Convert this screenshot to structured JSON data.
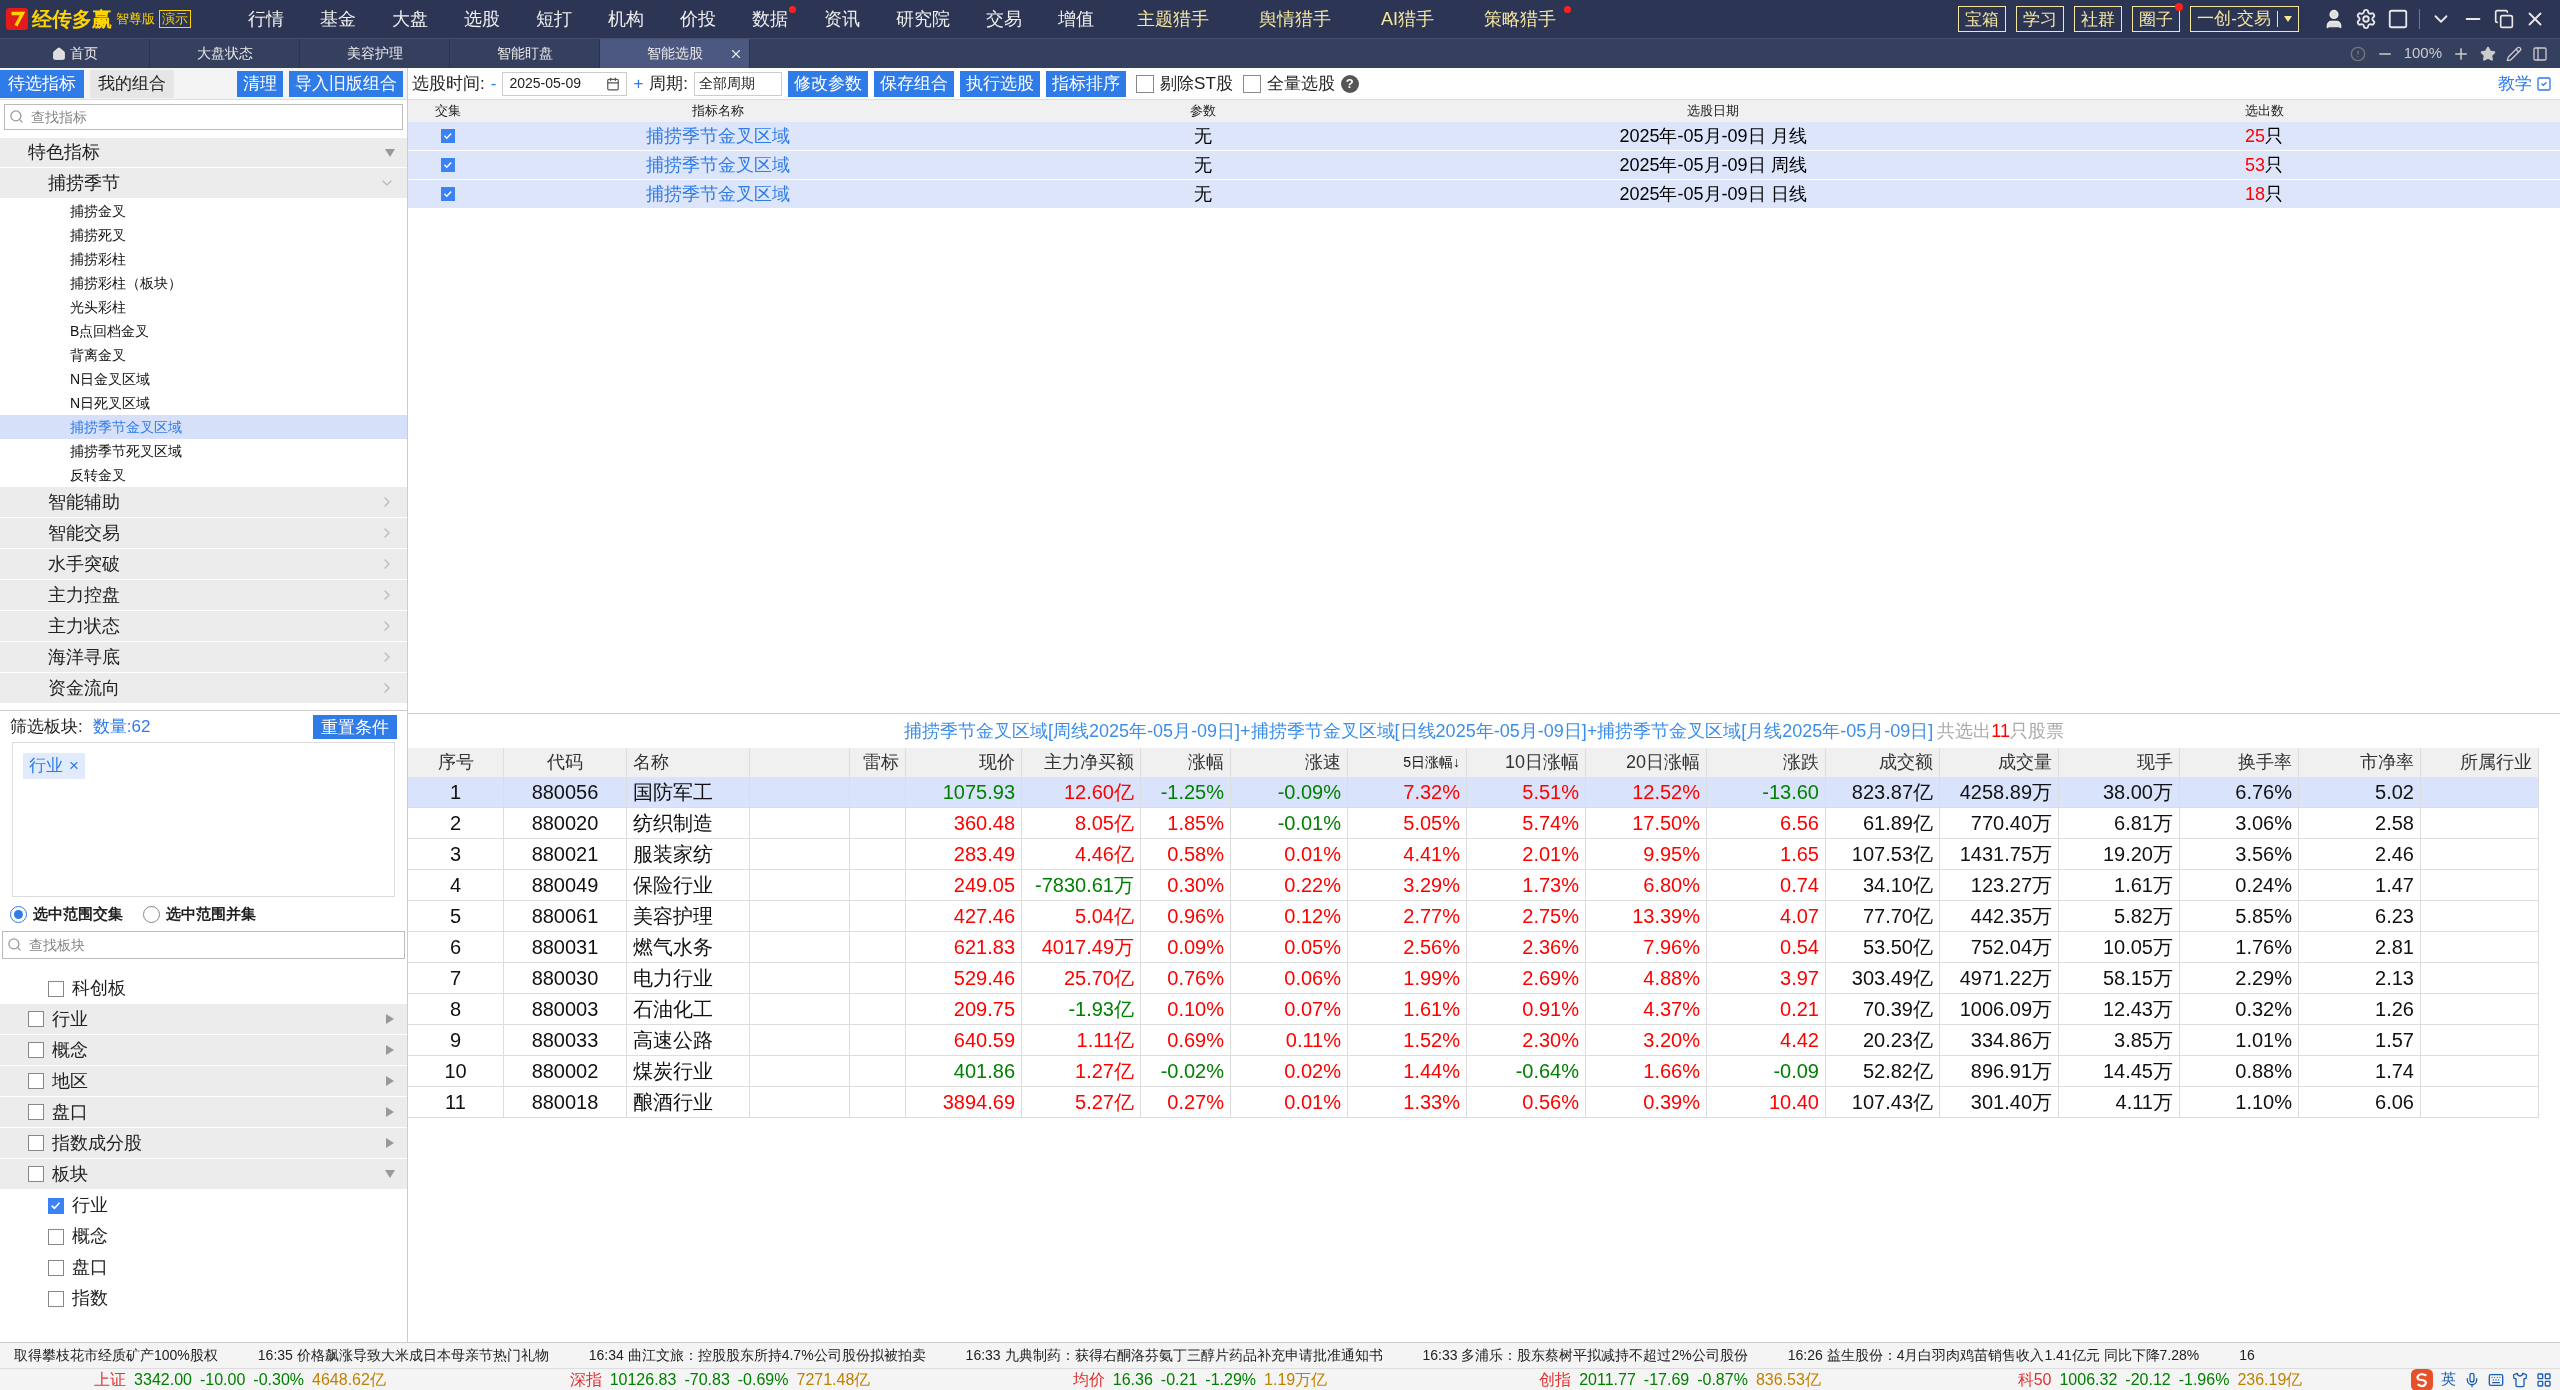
{
  "app": {
    "brand": "经传多赢",
    "edition": "智尊版",
    "mode": "演示"
  },
  "menu": [
    {
      "label": "行情",
      "kind": "plain",
      "dot": false
    },
    {
      "label": "基金",
      "kind": "plain",
      "dot": false
    },
    {
      "label": "大盘",
      "kind": "plain",
      "dot": false
    },
    {
      "label": "选股",
      "kind": "plain",
      "dot": false
    },
    {
      "label": "短打",
      "kind": "plain",
      "dot": false
    },
    {
      "label": "机构",
      "kind": "plain",
      "dot": false
    },
    {
      "label": "价投",
      "kind": "plain",
      "dot": false
    },
    {
      "label": "数据",
      "kind": "plain",
      "dot": true
    },
    {
      "label": "资讯",
      "kind": "plain",
      "dot": false
    },
    {
      "label": "研究院",
      "kind": "plain",
      "dot": false
    },
    {
      "label": "交易",
      "kind": "plain",
      "dot": false
    },
    {
      "label": "增值",
      "kind": "plain",
      "dot": false
    },
    {
      "label": "主题猎手",
      "kind": "hunter",
      "dot": false
    },
    {
      "label": "舆情猎手",
      "kind": "hunter",
      "dot": false
    },
    {
      "label": "AI猎手",
      "kind": "hunter",
      "dot": false
    },
    {
      "label": "策略猎手",
      "kind": "hunter",
      "dot": true
    }
  ],
  "top_buttons": [
    {
      "label": "宝箱",
      "dot": false
    },
    {
      "label": "学习",
      "dot": false
    },
    {
      "label": "社群",
      "dot": false
    },
    {
      "label": "圈子",
      "dot": true
    }
  ],
  "trade_button": {
    "label": "一创-交易"
  },
  "tabs": [
    {
      "label": "首页",
      "kind": "home",
      "selected": false
    },
    {
      "label": "大盘状态",
      "kind": "page",
      "selected": false
    },
    {
      "label": "美容护理",
      "kind": "page",
      "selected": false
    },
    {
      "label": "智能盯盘",
      "kind": "page",
      "selected": false
    },
    {
      "label": "智能选股",
      "kind": "page",
      "selected": true
    }
  ],
  "zoom": "100%",
  "left_tabs": [
    {
      "label": "待选指标",
      "selected": true
    },
    {
      "label": "我的组合",
      "selected": false
    }
  ],
  "left_buttons": [
    "清理",
    "导入旧版组合"
  ],
  "indicator_search": {
    "placeholder": "查找指标"
  },
  "toolbar": {
    "time_label": "选股时间:",
    "minus": "-",
    "date": "2025-05-09",
    "plus": "+",
    "period_label": "周期:",
    "period": "全部周期",
    "buttons": [
      "修改参数",
      "保存组合",
      "执行选股",
      "指标排序"
    ],
    "checks": [
      {
        "label": "剔除ST股",
        "checked": false
      },
      {
        "label": "全量选股",
        "checked": false
      }
    ],
    "help": "?",
    "teach": "教学"
  },
  "tree": [
    {
      "label": "特色指标",
      "expanded": true,
      "children": [
        {
          "label": "捕捞季节",
          "expanded": true,
          "children": [
            {
              "label": "捕捞金叉",
              "selected": false
            },
            {
              "label": "捕捞死叉",
              "selected": false
            },
            {
              "label": "捕捞彩柱",
              "selected": false
            },
            {
              "label": "捕捞彩柱（板块）",
              "selected": false
            },
            {
              "label": "光头彩柱",
              "selected": false
            },
            {
              "label": "B点回档金叉",
              "selected": false
            },
            {
              "label": "背离金叉",
              "selected": false
            },
            {
              "label": "N日金叉区域",
              "selected": false
            },
            {
              "label": "N日死叉区域",
              "selected": false
            },
            {
              "label": "捕捞季节金叉区域",
              "selected": true
            },
            {
              "label": "捕捞季节死叉区域",
              "selected": false
            },
            {
              "label": "反转金叉",
              "selected": false
            }
          ]
        },
        {
          "label": "智能辅助",
          "expanded": false
        },
        {
          "label": "智能交易",
          "expanded": false
        },
        {
          "label": "水手突破",
          "expanded": false
        },
        {
          "label": "主力控盘",
          "expanded": false
        },
        {
          "label": "主力状态",
          "expanded": false
        },
        {
          "label": "海洋寻底",
          "expanded": false
        },
        {
          "label": "资金流向",
          "expanded": false
        }
      ]
    }
  ],
  "filter": {
    "label": "筛选板块:",
    "count": "数量:62",
    "reset": "重置条件",
    "tags": [
      {
        "label": "行业",
        "remove": "×"
      }
    ],
    "modes": [
      {
        "label": "选中范围交集",
        "selected": true
      },
      {
        "label": "选中范围并集",
        "selected": false
      }
    ],
    "search": {
      "placeholder": "查找板块"
    },
    "orphan_children": [
      {
        "label": "科创板",
        "checked": false
      }
    ],
    "items": [
      {
        "label": "行业",
        "checked": false,
        "expanded": false
      },
      {
        "label": "概念",
        "checked": false,
        "expanded": false
      },
      {
        "label": "地区",
        "checked": false,
        "expanded": false
      },
      {
        "label": "盘口",
        "checked": false,
        "expanded": false
      },
      {
        "label": "指数成分股",
        "checked": false,
        "expanded": false
      },
      {
        "label": "板块",
        "checked": false,
        "expanded": true,
        "children": [
          {
            "label": "行业",
            "checked": true
          },
          {
            "label": "概念",
            "checked": false
          },
          {
            "label": "盘口",
            "checked": false
          },
          {
            "label": "指数",
            "checked": false
          }
        ]
      }
    ]
  },
  "combo_table": {
    "columns": [
      "交集",
      "指标名称",
      "参数",
      "选股日期",
      "选出数"
    ],
    "rows": [
      {
        "checked": true,
        "name": "捕捞季节金叉区域",
        "param": "无",
        "date": "2025年-05月-09日 月线",
        "count": "25",
        "unit": "只"
      },
      {
        "checked": true,
        "name": "捕捞季节金叉区域",
        "param": "无",
        "date": "2025年-05月-09日 周线",
        "count": "53",
        "unit": "只"
      },
      {
        "checked": true,
        "name": "捕捞季节金叉区域",
        "param": "无",
        "date": "2025年-05月-09日 日线",
        "count": "18",
        "unit": "只"
      }
    ]
  },
  "result": {
    "formula": "捕捞季节金叉区域[周线2025年-05月-09日]+捕捞季节金叉区域[日线2025年-05月-09日]+捕捞季节金叉区域[月线2025年-05月-09日]",
    "prefix": "共选出",
    "count": "11",
    "suffix": "只股票",
    "columns": [
      {
        "label": "序号",
        "sorted": false
      },
      {
        "label": "代码",
        "sorted": false
      },
      {
        "label": "名称",
        "sorted": false
      },
      {},
      {
        "label": "雷标",
        "sorted": false
      },
      {
        "label": "现价",
        "sorted": false
      },
      {
        "label": "主力净买额",
        "sorted": false
      },
      {
        "label": "涨幅",
        "sorted": false
      },
      {
        "label": "涨速",
        "sorted": false
      },
      {
        "label": "5日涨幅↓",
        "sorted": true
      },
      {
        "label": "10日涨幅",
        "sorted": false
      },
      {
        "label": "20日涨幅",
        "sorted": false
      },
      {
        "label": "涨跌",
        "sorted": false
      },
      {
        "label": "成交额",
        "sorted": false
      },
      {
        "label": "成交量",
        "sorted": false
      },
      {
        "label": "现手",
        "sorted": false
      },
      {
        "label": "换手率",
        "sorted": false
      },
      {
        "label": "市净率",
        "sorted": false
      },
      {
        "label": "所属行业",
        "sorted": false
      }
    ],
    "rows": [
      {
        "selected": true,
        "cells": [
          {
            "text": "1"
          },
          {
            "text": "880056"
          },
          {
            "text": "国防军工"
          },
          {
            "text": ""
          },
          {
            "text": ""
          },
          {
            "text": "1075.93",
            "color": "#008000"
          },
          {
            "text": "12.60亿",
            "color": "#ff0000"
          },
          {
            "text": "-1.25%",
            "color": "#008000"
          },
          {
            "text": "-0.09%",
            "color": "#008000"
          },
          {
            "text": "7.32%",
            "color": "#ff0000"
          },
          {
            "text": "5.51%",
            "color": "#ff0000"
          },
          {
            "text": "12.52%",
            "color": "#ff0000"
          },
          {
            "text": "-13.60",
            "color": "#008000"
          },
          {
            "text": "823.87亿"
          },
          {
            "text": "4258.89万"
          },
          {
            "text": "38.00万"
          },
          {
            "text": "6.76%"
          },
          {
            "text": "5.02"
          },
          {
            "text": ""
          }
        ]
      },
      {
        "selected": false,
        "cells": [
          {
            "text": "2"
          },
          {
            "text": "880020"
          },
          {
            "text": "纺织制造"
          },
          {
            "text": ""
          },
          {
            "text": ""
          },
          {
            "text": "360.48",
            "color": "#ff0000"
          },
          {
            "text": "8.05亿",
            "color": "#ff0000"
          },
          {
            "text": "1.85%",
            "color": "#ff0000"
          },
          {
            "text": "-0.01%",
            "color": "#008000"
          },
          {
            "text": "5.05%",
            "color": "#ff0000"
          },
          {
            "text": "5.74%",
            "color": "#ff0000"
          },
          {
            "text": "17.50%",
            "color": "#ff0000"
          },
          {
            "text": "6.56",
            "color": "#ff0000"
          },
          {
            "text": "61.89亿"
          },
          {
            "text": "770.40万"
          },
          {
            "text": "6.81万"
          },
          {
            "text": "3.06%"
          },
          {
            "text": "2.58"
          },
          {
            "text": ""
          }
        ]
      },
      {
        "selected": false,
        "cells": [
          {
            "text": "3"
          },
          {
            "text": "880021"
          },
          {
            "text": "服装家纺"
          },
          {
            "text": ""
          },
          {
            "text": ""
          },
          {
            "text": "283.49",
            "color": "#ff0000"
          },
          {
            "text": "4.46亿",
            "color": "#ff0000"
          },
          {
            "text": "0.58%",
            "color": "#ff0000"
          },
          {
            "text": "0.01%",
            "color": "#ff0000"
          },
          {
            "text": "4.41%",
            "color": "#ff0000"
          },
          {
            "text": "2.01%",
            "color": "#ff0000"
          },
          {
            "text": "9.95%",
            "color": "#ff0000"
          },
          {
            "text": "1.65",
            "color": "#ff0000"
          },
          {
            "text": "107.53亿"
          },
          {
            "text": "1431.75万"
          },
          {
            "text": "19.20万"
          },
          {
            "text": "3.56%"
          },
          {
            "text": "2.46"
          },
          {
            "text": ""
          }
        ]
      },
      {
        "selected": false,
        "cells": [
          {
            "text": "4"
          },
          {
            "text": "880049"
          },
          {
            "text": "保险行业"
          },
          {
            "text": ""
          },
          {
            "text": ""
          },
          {
            "text": "249.05",
            "color": "#ff0000"
          },
          {
            "text": "-7830.61万",
            "color": "#008000"
          },
          {
            "text": "0.30%",
            "color": "#ff0000"
          },
          {
            "text": "0.22%",
            "color": "#ff0000"
          },
          {
            "text": "3.29%",
            "color": "#ff0000"
          },
          {
            "text": "1.73%",
            "color": "#ff0000"
          },
          {
            "text": "6.80%",
            "color": "#ff0000"
          },
          {
            "text": "0.74",
            "color": "#ff0000"
          },
          {
            "text": "34.10亿"
          },
          {
            "text": "123.27万"
          },
          {
            "text": "1.61万"
          },
          {
            "text": "0.24%"
          },
          {
            "text": "1.47"
          },
          {
            "text": ""
          }
        ]
      },
      {
        "selected": false,
        "cells": [
          {
            "text": "5"
          },
          {
            "text": "880061"
          },
          {
            "text": "美容护理"
          },
          {
            "text": ""
          },
          {
            "text": ""
          },
          {
            "text": "427.46",
            "color": "#ff0000"
          },
          {
            "text": "5.04亿",
            "color": "#ff0000"
          },
          {
            "text": "0.96%",
            "color": "#ff0000"
          },
          {
            "text": "0.12%",
            "color": "#ff0000"
          },
          {
            "text": "2.77%",
            "color": "#ff0000"
          },
          {
            "text": "2.75%",
            "color": "#ff0000"
          },
          {
            "text": "13.39%",
            "color": "#ff0000"
          },
          {
            "text": "4.07",
            "color": "#ff0000"
          },
          {
            "text": "77.70亿"
          },
          {
            "text": "442.35万"
          },
          {
            "text": "5.82万"
          },
          {
            "text": "5.85%"
          },
          {
            "text": "6.23"
          },
          {
            "text": ""
          }
        ]
      },
      {
        "selected": false,
        "cells": [
          {
            "text": "6"
          },
          {
            "text": "880031"
          },
          {
            "text": "燃气水务"
          },
          {
            "text": ""
          },
          {
            "text": ""
          },
          {
            "text": "621.83",
            "color": "#ff0000"
          },
          {
            "text": "4017.49万",
            "color": "#ff0000"
          },
          {
            "text": "0.09%",
            "color": "#ff0000"
          },
          {
            "text": "0.05%",
            "color": "#ff0000"
          },
          {
            "text": "2.56%",
            "color": "#ff0000"
          },
          {
            "text": "2.36%",
            "color": "#ff0000"
          },
          {
            "text": "7.96%",
            "color": "#ff0000"
          },
          {
            "text": "0.54",
            "color": "#ff0000"
          },
          {
            "text": "53.50亿"
          },
          {
            "text": "752.04万"
          },
          {
            "text": "10.05万"
          },
          {
            "text": "1.76%"
          },
          {
            "text": "2.81"
          },
          {
            "text": ""
          }
        ]
      },
      {
        "selected": false,
        "cells": [
          {
            "text": "7"
          },
          {
            "text": "880030"
          },
          {
            "text": "电力行业"
          },
          {
            "text": ""
          },
          {
            "text": ""
          },
          {
            "text": "529.46",
            "color": "#ff0000"
          },
          {
            "text": "25.70亿",
            "color": "#ff0000"
          },
          {
            "text": "0.76%",
            "color": "#ff0000"
          },
          {
            "text": "0.06%",
            "color": "#ff0000"
          },
          {
            "text": "1.99%",
            "color": "#ff0000"
          },
          {
            "text": "2.69%",
            "color": "#ff0000"
          },
          {
            "text": "4.88%",
            "color": "#ff0000"
          },
          {
            "text": "3.97",
            "color": "#ff0000"
          },
          {
            "text": "303.49亿"
          },
          {
            "text": "4971.22万"
          },
          {
            "text": "58.15万"
          },
          {
            "text": "2.29%"
          },
          {
            "text": "2.13"
          },
          {
            "text": ""
          }
        ]
      },
      {
        "selected": false,
        "cells": [
          {
            "text": "8"
          },
          {
            "text": "880003"
          },
          {
            "text": "石油化工"
          },
          {
            "text": ""
          },
          {
            "text": ""
          },
          {
            "text": "209.75",
            "color": "#ff0000"
          },
          {
            "text": "-1.93亿",
            "color": "#008000"
          },
          {
            "text": "0.10%",
            "color": "#ff0000"
          },
          {
            "text": "0.07%",
            "color": "#ff0000"
          },
          {
            "text": "1.61%",
            "color": "#ff0000"
          },
          {
            "text": "0.91%",
            "color": "#ff0000"
          },
          {
            "text": "4.37%",
            "color": "#ff0000"
          },
          {
            "text": "0.21",
            "color": "#ff0000"
          },
          {
            "text": "70.39亿"
          },
          {
            "text": "1006.09万"
          },
          {
            "text": "12.43万"
          },
          {
            "text": "0.32%"
          },
          {
            "text": "1.26"
          },
          {
            "text": ""
          }
        ]
      },
      {
        "selected": false,
        "cells": [
          {
            "text": "9"
          },
          {
            "text": "880033"
          },
          {
            "text": "高速公路"
          },
          {
            "text": ""
          },
          {
            "text": ""
          },
          {
            "text": "640.59",
            "color": "#ff0000"
          },
          {
            "text": "1.11亿",
            "color": "#ff0000"
          },
          {
            "text": "0.69%",
            "color": "#ff0000"
          },
          {
            "text": "0.11%",
            "color": "#ff0000"
          },
          {
            "text": "1.52%",
            "color": "#ff0000"
          },
          {
            "text": "2.30%",
            "color": "#ff0000"
          },
          {
            "text": "3.20%",
            "color": "#ff0000"
          },
          {
            "text": "4.42",
            "color": "#ff0000"
          },
          {
            "text": "20.23亿"
          },
          {
            "text": "334.86万"
          },
          {
            "text": "3.85万"
          },
          {
            "text": "1.01%"
          },
          {
            "text": "1.57"
          },
          {
            "text": ""
          }
        ]
      },
      {
        "selected": false,
        "cells": [
          {
            "text": "10"
          },
          {
            "text": "880002"
          },
          {
            "text": "煤炭行业"
          },
          {
            "text": ""
          },
          {
            "text": ""
          },
          {
            "text": "401.86",
            "color": "#008000"
          },
          {
            "text": "1.27亿",
            "color": "#ff0000"
          },
          {
            "text": "-0.02%",
            "color": "#008000"
          },
          {
            "text": "0.02%",
            "color": "#ff0000"
          },
          {
            "text": "1.44%",
            "color": "#ff0000"
          },
          {
            "text": "-0.64%",
            "color": "#008000"
          },
          {
            "text": "1.66%",
            "color": "#ff0000"
          },
          {
            "text": "-0.09",
            "color": "#008000"
          },
          {
            "text": "52.82亿"
          },
          {
            "text": "896.91万"
          },
          {
            "text": "14.45万"
          },
          {
            "text": "0.88%"
          },
          {
            "text": "1.74"
          },
          {
            "text": ""
          }
        ]
      },
      {
        "selected": false,
        "cells": [
          {
            "text": "11"
          },
          {
            "text": "880018"
          },
          {
            "text": "酿酒行业"
          },
          {
            "text": ""
          },
          {
            "text": ""
          },
          {
            "text": "3894.69",
            "color": "#ff0000"
          },
          {
            "text": "5.27亿",
            "color": "#ff0000"
          },
          {
            "text": "0.27%",
            "color": "#ff0000"
          },
          {
            "text": "0.01%",
            "color": "#ff0000"
          },
          {
            "text": "1.33%",
            "color": "#ff0000"
          },
          {
            "text": "0.56%",
            "color": "#ff0000"
          },
          {
            "text": "0.39%",
            "color": "#ff0000"
          },
          {
            "text": "10.40",
            "color": "#ff0000"
          },
          {
            "text": "107.43亿"
          },
          {
            "text": "301.40万"
          },
          {
            "text": "4.11万"
          },
          {
            "text": "1.10%"
          },
          {
            "text": "6.06"
          },
          {
            "text": ""
          }
        ]
      }
    ]
  },
  "news": [
    "取得攀枝花市经质矿产100%股权",
    "16:35 价格飙涨导致大米成日本母亲节热门礼物",
    "16:34 曲江文旅：控股股东所持4.7%公司股份拟被拍卖",
    "16:33 九典制药：获得右酮洛芬氨丁三醇片药品补充申请批准通知书",
    "16:33 多浦乐：股东蔡树平拟减持不超过2%公司股份",
    "16:26 益生股份：4月白羽肉鸡苗销售收入1.41亿元 同比下降7.28%",
    "16"
  ],
  "indices": [
    {
      "name": "上证",
      "price": "3342.00",
      "change": "-10.00",
      "pct": "-0.30%",
      "amount": "4648.62亿",
      "color": "#008000"
    },
    {
      "name": "深指",
      "price": "10126.83",
      "change": "-70.83",
      "pct": "-0.69%",
      "amount": "7271.48亿",
      "color": "#008000"
    },
    {
      "name": "均价",
      "price": "16.36",
      "change": "-0.21",
      "pct": "-1.29%",
      "amount": "1.19万亿",
      "color": "#008000"
    },
    {
      "name": "创指",
      "price": "2011.77",
      "change": "-17.69",
      "pct": "-0.87%",
      "amount": "836.53亿",
      "color": "#008000"
    },
    {
      "name": "科50",
      "price": "1006.32",
      "change": "-20.12",
      "pct": "-1.96%",
      "amount": "236.19亿",
      "color": "#008000"
    }
  ],
  "tray": {
    "ime": "英"
  }
}
